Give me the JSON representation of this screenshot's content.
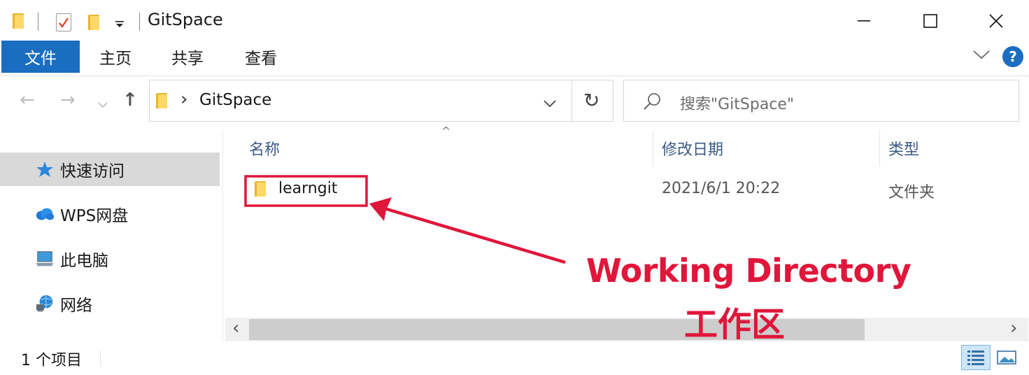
{
  "window": {
    "title": "GitSpace",
    "minimize_glyph": "—",
    "maximize_glyph": "☐",
    "close_glyph": "✕"
  },
  "ribbon": {
    "tabs": [
      "文件",
      "主页",
      "共享",
      "查看"
    ],
    "help_glyph": "?",
    "collapse_glyph": "⌄",
    "active_color": "#1a6dc0"
  },
  "navigation": {
    "back_glyph": "←",
    "forward_glyph": "→",
    "recent_glyph": "⌄",
    "up_glyph": "↑",
    "path_sep": "›",
    "path": "GitSpace",
    "refresh_glyph": "↻",
    "search_placeholder": "搜索\"GitSpace\""
  },
  "sidebar": {
    "items": [
      {
        "label": "快速访问",
        "icon": "star-icon"
      },
      {
        "label": "WPS网盘",
        "icon": "cloud-icon"
      },
      {
        "label": "此电脑",
        "icon": "computer-icon"
      },
      {
        "label": "网络",
        "icon": "network-icon"
      }
    ]
  },
  "file_list": {
    "columns": [
      "名称",
      "修改日期",
      "类型"
    ],
    "sort_glyph": "^",
    "rows": [
      {
        "name": "learngit",
        "modified": "2021/6/1 20:22",
        "type": "文件夹"
      }
    ]
  },
  "annotation": {
    "line1": "Working Directory",
    "line2": "工作区",
    "color": "#e0163a"
  },
  "status": {
    "item_count": "1 个项目"
  },
  "scroll": {
    "left_glyph": "‹",
    "right_glyph": "›"
  }
}
